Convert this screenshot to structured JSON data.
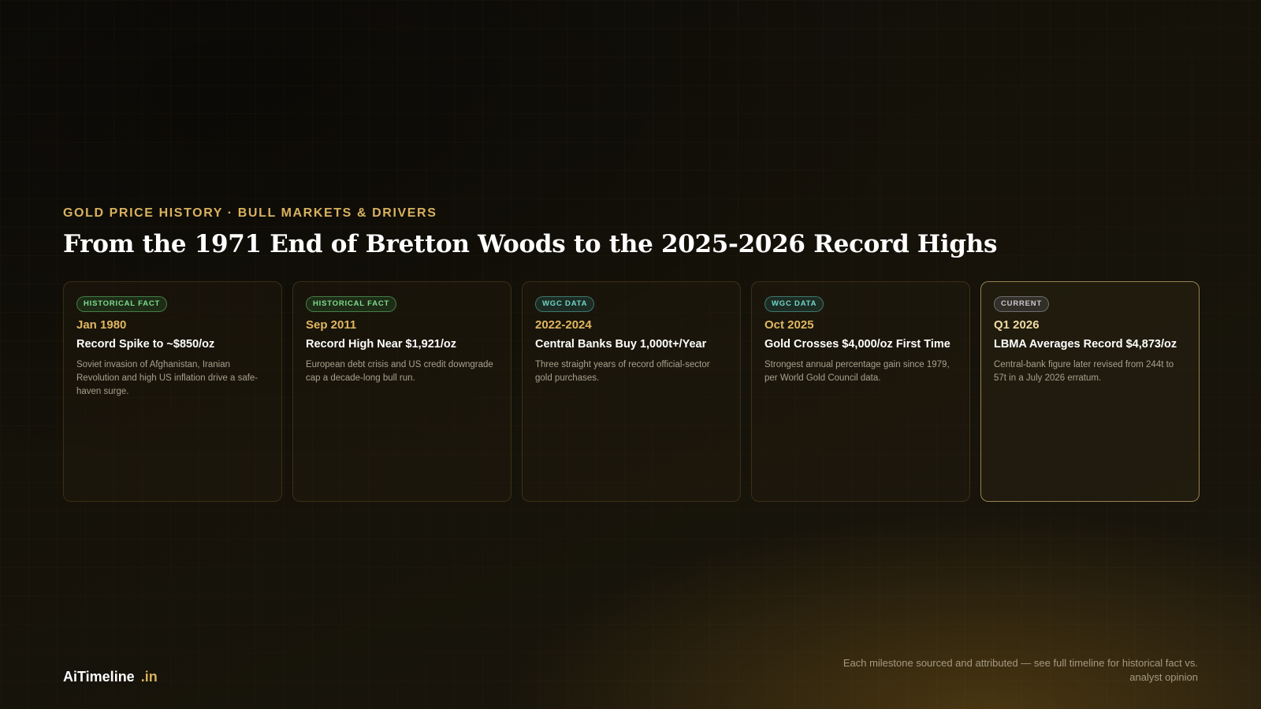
{
  "header": {
    "eyebrow": "GOLD PRICE HISTORY · BULL MARKETS & DRIVERS",
    "title": "From the 1971 End of Bretton Woods to the 2025-2026 Record Highs"
  },
  "cards": [
    {
      "badge": "HISTORICAL FACT",
      "date": "Jan 1980",
      "title": "Record Spike to ~$850/oz",
      "description": "Soviet invasion of Afghanistan, Iranian Revolution and high US inflation drive a safe-haven surge."
    },
    {
      "badge": "HISTORICAL FACT",
      "date": "Sep 2011",
      "title": "Record High Near $1,921/oz",
      "description": "European debt crisis and US credit downgrade cap a decade-long bull run."
    },
    {
      "badge": "WGC DATA",
      "date": "2022-2024",
      "title": "Central Banks Buy 1,000t+/Year",
      "description": "Three straight years of record official-sector gold purchases."
    },
    {
      "badge": "WGC DATA",
      "date": "Oct 2025",
      "title": "Gold Crosses $4,000/oz First Time",
      "description": "Strongest annual percentage gain since 1979, per World Gold Council data."
    },
    {
      "badge": "CURRENT",
      "date": "Q1 2026",
      "title": "LBMA Averages Record $4,873/oz",
      "description": "Central-bank figure later revised from 244t to 57t in a July 2026 erratum."
    }
  ],
  "footer": {
    "brand_name": "AiTimeline",
    "brand_suffix": ".in",
    "note": "Each milestone sourced and attributed — see full timeline for historical fact vs. analyst opinion"
  },
  "colors": {
    "accent_gold": "#d9b25f",
    "badge_historical_fact": "#7fdc8f",
    "badge_wgc_data": "#6fd6c9",
    "badge_current": "#c8c8d0",
    "background": "#14110b"
  }
}
